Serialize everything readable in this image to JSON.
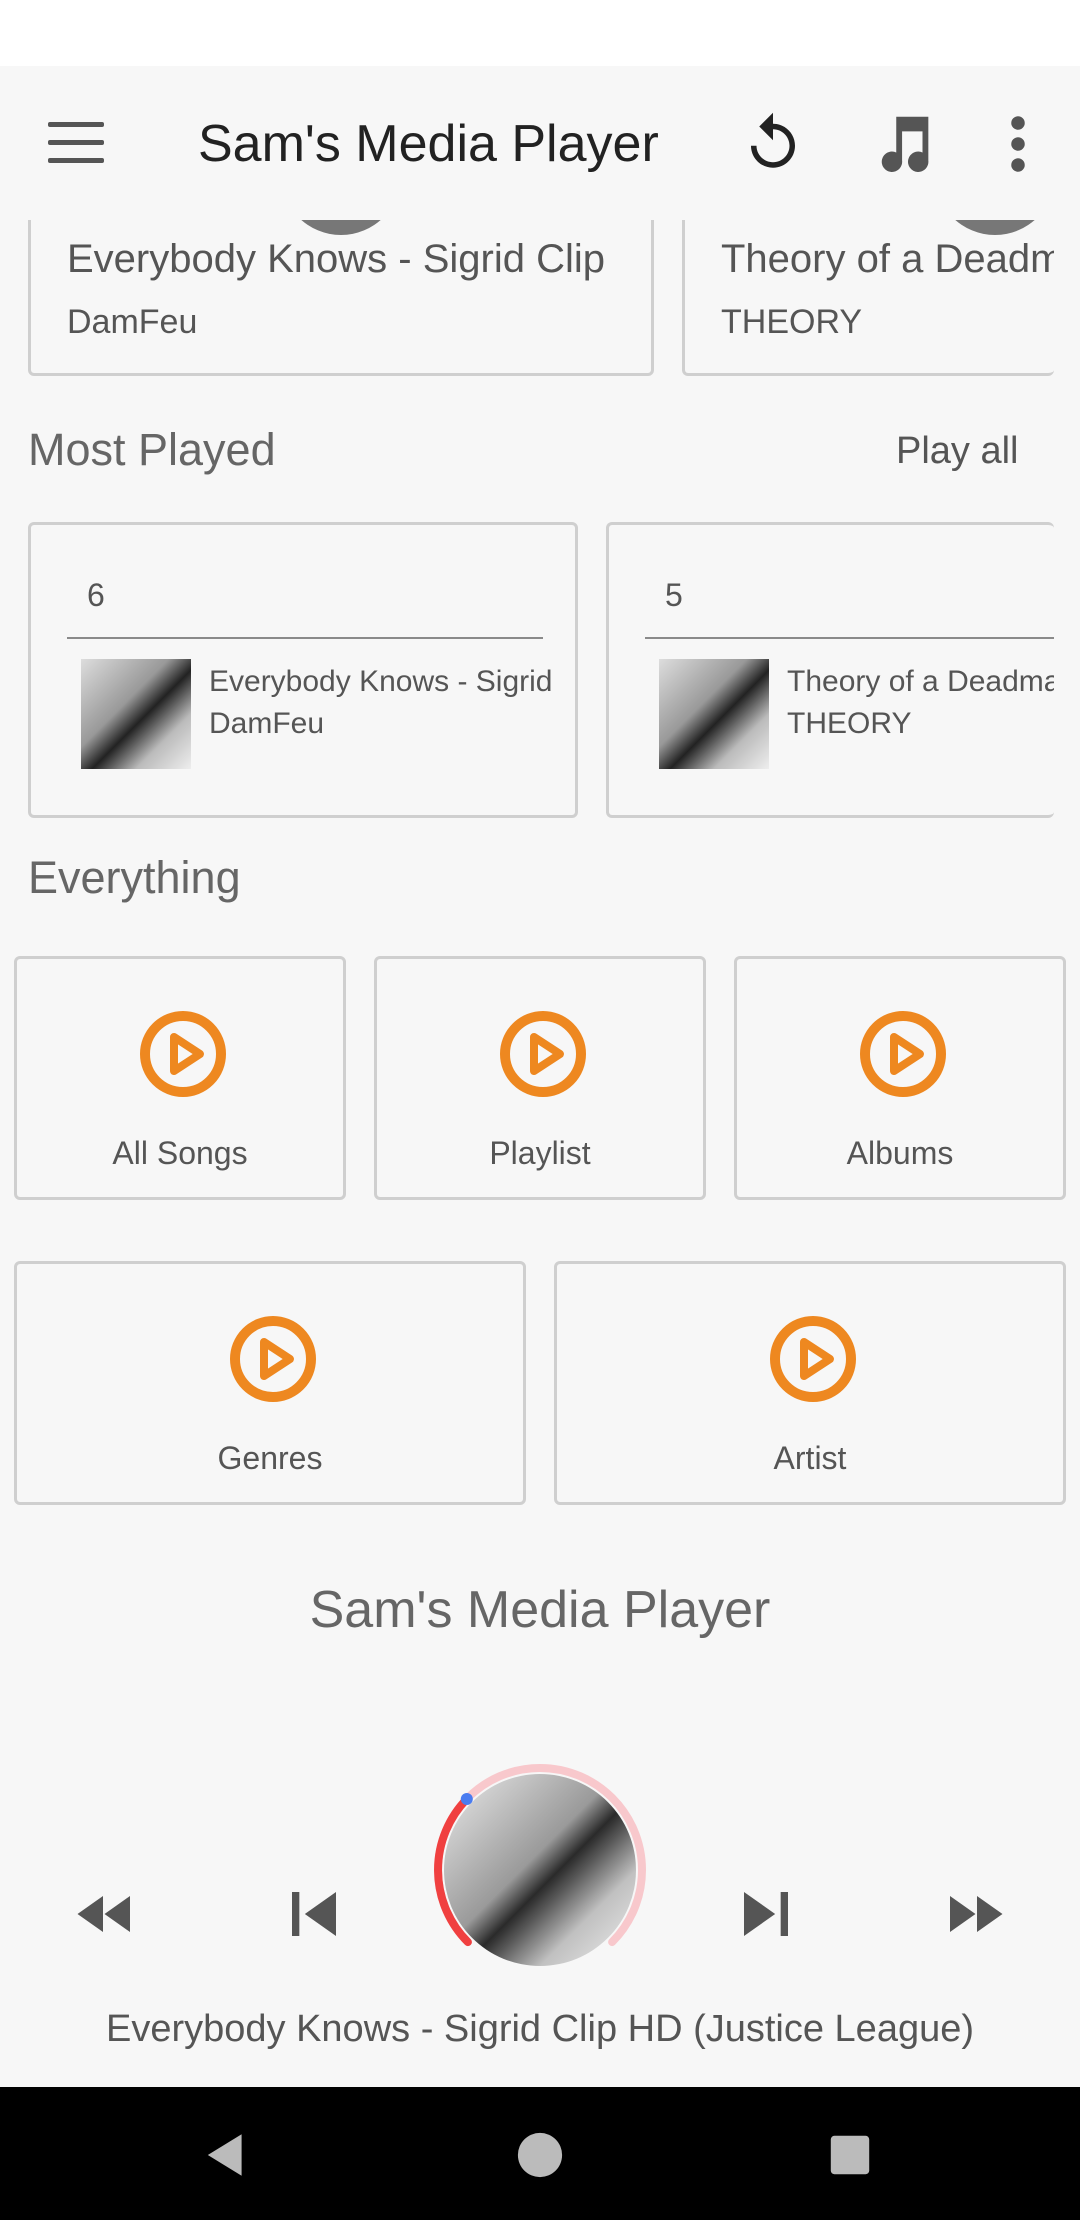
{
  "app": {
    "title": "Sam's Media Player"
  },
  "toolbar": {
    "menu_icon": "menu-icon",
    "refresh_icon": "refresh-icon",
    "music_icon": "music-note-icon",
    "more_icon": "more-vert-icon"
  },
  "recent": [
    {
      "title": "Everybody Knows - Sigrid Clip",
      "artist": "DamFeu"
    },
    {
      "title": "Theory of a Deadman",
      "artist": "THEORY"
    }
  ],
  "most_played": {
    "heading": "Most Played",
    "play_all": "Play all",
    "items": [
      {
        "count": "6",
        "title": "Everybody Knows - Sigrid",
        "artist": "DamFeu"
      },
      {
        "count": "5",
        "title": "Theory of a Deadman",
        "artist": "THEORY"
      }
    ]
  },
  "everything": {
    "heading": "Everything",
    "categories": [
      {
        "label": "All Songs",
        "icon": "play-circle-icon"
      },
      {
        "label": "Playlist",
        "icon": "play-circle-icon"
      },
      {
        "label": "Albums",
        "icon": "play-circle-icon"
      },
      {
        "label": "Genres",
        "icon": "play-circle-icon"
      },
      {
        "label": "Artist",
        "icon": "play-circle-icon"
      }
    ]
  },
  "footer_title": "Sam's Media Player",
  "player": {
    "now_playing": "Everybody Knows - Sigrid Clip HD (Justice League)",
    "progress": 0.33
  },
  "colors": {
    "accent": "#ee8820",
    "progress": "#f04040",
    "progress_track": "#f8c8cc"
  }
}
